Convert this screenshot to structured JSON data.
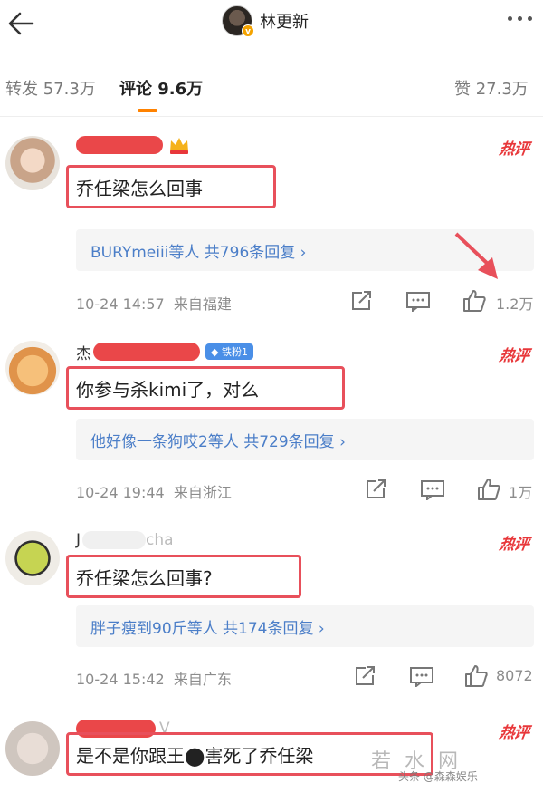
{
  "header": {
    "title": "林更新",
    "verified_mark": "v"
  },
  "tabs": [
    {
      "label": "转发 57.3万"
    },
    {
      "label": "评论 9.6万"
    },
    {
      "label": "赞 27.3万"
    }
  ],
  "comments": [
    {
      "hot_label": "热评",
      "text": "乔任梁怎么回事",
      "reply_summary": "BURYmeiii等人  共796条回复 ›",
      "time": "10-24 14:57",
      "location": "来自福建",
      "likes": "1.2万"
    },
    {
      "name_prefix": "杰",
      "fan_badge": "铁粉1",
      "hot_label": "热评",
      "text": "你参与杀kimi了，对么",
      "reply_summary": "他好像一条狗哎2等人  共729条回复 ›",
      "time": "10-24 19:44",
      "location": "来自浙江",
      "likes": "1万"
    },
    {
      "name_prefix": "J",
      "name_suffix": "cha",
      "hot_label": "热评",
      "text": "乔任梁怎么回事?",
      "reply_summary": "胖子瘦到90斤等人  共174条回复 ›",
      "time": "10-24 15:42",
      "location": "来自广东",
      "likes": "8072"
    },
    {
      "name_suffix": "V",
      "hot_label": "热评",
      "text": "是不是你跟王⬤害死了乔任梁"
    }
  ],
  "watermark": {
    "text": "若 水 网",
    "source": "头条 @森森娱乐"
  },
  "colors": {
    "accent": "#ff8200",
    "hot": "#e8373a",
    "link": "#4b7ec8",
    "highlight_box": "#e8505b"
  }
}
